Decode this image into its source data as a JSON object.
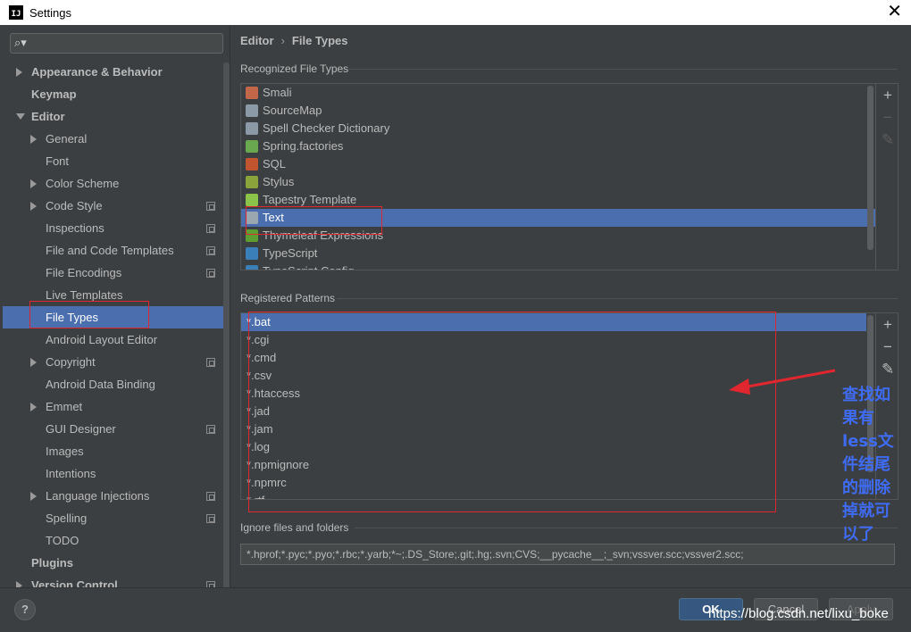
{
  "window": {
    "title": "Settings",
    "icon_letters": "IJ"
  },
  "search": {
    "placeholder": ""
  },
  "sidebar": {
    "items": [
      {
        "label": "Appearance & Behavior",
        "level": 0,
        "bold": true,
        "arrow": "right"
      },
      {
        "label": "Keymap",
        "level": 0,
        "bold": true,
        "arrow": ""
      },
      {
        "label": "Editor",
        "level": 0,
        "bold": true,
        "arrow": "down"
      },
      {
        "label": "General",
        "level": 1,
        "arrow": "right"
      },
      {
        "label": "Font",
        "level": 1,
        "arrow": ""
      },
      {
        "label": "Color Scheme",
        "level": 1,
        "arrow": "right"
      },
      {
        "label": "Code Style",
        "level": 1,
        "arrow": "right",
        "project": true
      },
      {
        "label": "Inspections",
        "level": 1,
        "arrow": "",
        "project": true
      },
      {
        "label": "File and Code Templates",
        "level": 1,
        "arrow": "",
        "project": true
      },
      {
        "label": "File Encodings",
        "level": 1,
        "arrow": "",
        "project": true
      },
      {
        "label": "Live Templates",
        "level": 1,
        "arrow": ""
      },
      {
        "label": "File Types",
        "level": 1,
        "arrow": "",
        "selected": true
      },
      {
        "label": "Android Layout Editor",
        "level": 1,
        "arrow": ""
      },
      {
        "label": "Copyright",
        "level": 1,
        "arrow": "right",
        "project": true
      },
      {
        "label": "Android Data Binding",
        "level": 1,
        "arrow": ""
      },
      {
        "label": "Emmet",
        "level": 1,
        "arrow": "right"
      },
      {
        "label": "GUI Designer",
        "level": 1,
        "arrow": "",
        "project": true
      },
      {
        "label": "Images",
        "level": 1,
        "arrow": ""
      },
      {
        "label": "Intentions",
        "level": 1,
        "arrow": ""
      },
      {
        "label": "Language Injections",
        "level": 1,
        "arrow": "right",
        "project": true
      },
      {
        "label": "Spelling",
        "level": 1,
        "arrow": "",
        "project": true
      },
      {
        "label": "TODO",
        "level": 1,
        "arrow": ""
      },
      {
        "label": "Plugins",
        "level": 0,
        "bold": true,
        "arrow": ""
      },
      {
        "label": "Version Control",
        "level": 0,
        "bold": true,
        "arrow": "right",
        "project": true
      }
    ]
  },
  "breadcrumb": {
    "parent": "Editor",
    "separator": "›",
    "current": "File Types"
  },
  "recognized": {
    "label": "Recognized File Types",
    "items": [
      {
        "label": "Smali",
        "icon": "smali-icon",
        "color": "#c2674a"
      },
      {
        "label": "SourceMap",
        "icon": "sourcemap-icon",
        "color": "#8c9aa8"
      },
      {
        "label": "Spell Checker Dictionary",
        "icon": "dictionary-icon",
        "color": "#8c9aa8"
      },
      {
        "label": "Spring.factories",
        "icon": "spring-icon",
        "color": "#6aa84f"
      },
      {
        "label": "SQL",
        "icon": "sql-icon",
        "color": "#c0552f"
      },
      {
        "label": "Stylus",
        "icon": "stylus-icon",
        "color": "#8aa33a"
      },
      {
        "label": "Tapestry Template",
        "icon": "tapestry-icon",
        "color": "#8bc34a"
      },
      {
        "label": "Text",
        "icon": "text-file-icon",
        "color": "#9aa7b0",
        "selected": true
      },
      {
        "label": "Thymeleaf Expressions",
        "icon": "thymeleaf-icon",
        "color": "#5c9e31"
      },
      {
        "label": "TypeScript",
        "icon": "typescript-icon",
        "color": "#3b7fb8"
      },
      {
        "label": "TypeScript Config",
        "icon": "tsconfig-icon",
        "color": "#3b7fb8"
      }
    ]
  },
  "patterns": {
    "label": "Registered Patterns",
    "items": [
      "*.bat",
      "*.cgi",
      "*.cmd",
      "*.csv",
      "*.htaccess",
      "*.jad",
      "*.jam",
      "*.log",
      "*.npmignore",
      "*.npmrc",
      "*.rtf"
    ]
  },
  "tools": {
    "add": "+",
    "remove": "−",
    "edit": "✎"
  },
  "ignore": {
    "label": "Ignore files and folders",
    "value": "*.hprof;*.pyc;*.pyo;*.rbc;*.yarb;*~;.DS_Store;.git;.hg;.svn;CVS;__pycache__;_svn;vssver.scc;vssver2.scc;"
  },
  "buttons": {
    "help": "?",
    "ok": "OK",
    "cancel": "Cancel",
    "apply": "Apply"
  },
  "annotation": {
    "text": "查找如果有less文件结尾的删除掉就可以了"
  },
  "watermark": {
    "text": "https://blog.csdn.net/lixu_boke"
  },
  "colors": {
    "selection": "#4b6eaf",
    "background": "#3c3f41",
    "annotation": "#3f6cf6",
    "highlight_box": "#e0262e"
  }
}
